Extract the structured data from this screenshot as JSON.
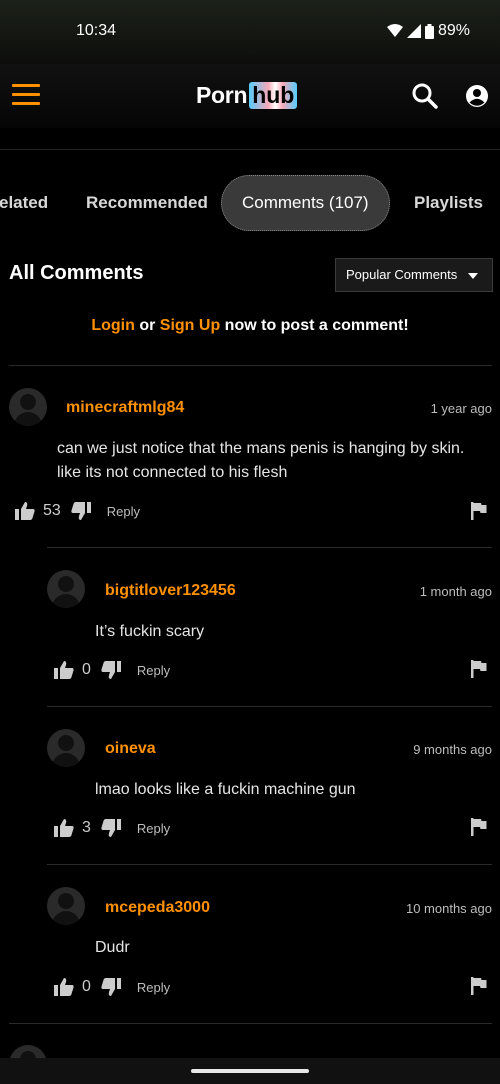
{
  "status_bar": {
    "time": "10:34",
    "battery": "89%"
  },
  "header": {
    "logo_part1": "Porn",
    "logo_part2": "hub",
    "brand_color": "#ff9000",
    "icons": [
      "hamburger-menu-icon",
      "search-icon",
      "account-icon"
    ]
  },
  "tabs": [
    {
      "label": "elated"
    },
    {
      "label": "Recommended"
    },
    {
      "label": "Comments (107)",
      "active": true
    },
    {
      "label": "Playlists"
    }
  ],
  "comments_section": {
    "title": "All Comments",
    "sort_selected": "Popular Comments",
    "login_prompt": {
      "login": "Login",
      "or": "or",
      "signup": "Sign Up",
      "rest": "now to post a comment!"
    }
  },
  "comments": [
    {
      "username": "minecraftmlg84",
      "time": "1 year ago",
      "text": "can we just notice that the mans penis is hanging by skin. like its not connected to his flesh",
      "likes": "53",
      "reply": "Reply"
    },
    {
      "username": "bigtitlover123456",
      "time": "1 month ago",
      "text": "It’s fuckin scary",
      "likes": "0",
      "reply": "Reply"
    },
    {
      "username": "oineva",
      "time": "9 months ago",
      "text": "lmao looks like a fuckin machine gun",
      "likes": "3",
      "reply": "Reply"
    },
    {
      "username": "mcepeda3000",
      "time": "10 months ago",
      "text": "Dudr",
      "likes": "0",
      "reply": "Reply"
    }
  ]
}
